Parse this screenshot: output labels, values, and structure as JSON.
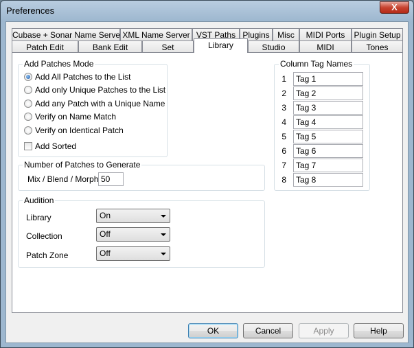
{
  "window": {
    "title": "Preferences",
    "close_label": "X"
  },
  "tabs": {
    "back_row": [
      "Cubase + Sonar Name Server",
      "XML Name Server",
      "VST Paths",
      "Plugins",
      "Misc",
      "MIDI Ports",
      "Plugin Setup"
    ],
    "front_row": [
      "Patch Edit",
      "Bank Edit",
      "Set",
      "Library",
      "Studio",
      "MIDI",
      "Tones"
    ],
    "active": "Library"
  },
  "add_patches": {
    "title": "Add Patches Mode",
    "options": [
      "Add All Patches to the List",
      "Add only Unique Patches to the List",
      "Add any Patch with a Unique Name",
      "Verify on Name Match",
      "Verify on Identical Patch"
    ],
    "selected_index": 0,
    "add_sorted_label": "Add Sorted",
    "add_sorted_checked": false
  },
  "generate": {
    "title": "Number of Patches to Generate",
    "label": "Mix / Blend / Morph",
    "value": "50"
  },
  "audition": {
    "title": "Audition",
    "library_label": "Library",
    "library_value": "On",
    "collection_label": "Collection",
    "collection_value": "Off",
    "patch_zone_label": "Patch Zone",
    "patch_zone_value": "Off"
  },
  "column_tags": {
    "title": "Column Tag Names",
    "numbers": [
      "1",
      "2",
      "3",
      "4",
      "5",
      "6",
      "7",
      "8"
    ],
    "values": [
      "Tag 1",
      "Tag 2",
      "Tag 3",
      "Tag 4",
      "Tag 5",
      "Tag 6",
      "Tag 7",
      "Tag 8"
    ]
  },
  "buttons": {
    "ok": "OK",
    "cancel": "Cancel",
    "apply": "Apply",
    "help": "Help"
  }
}
